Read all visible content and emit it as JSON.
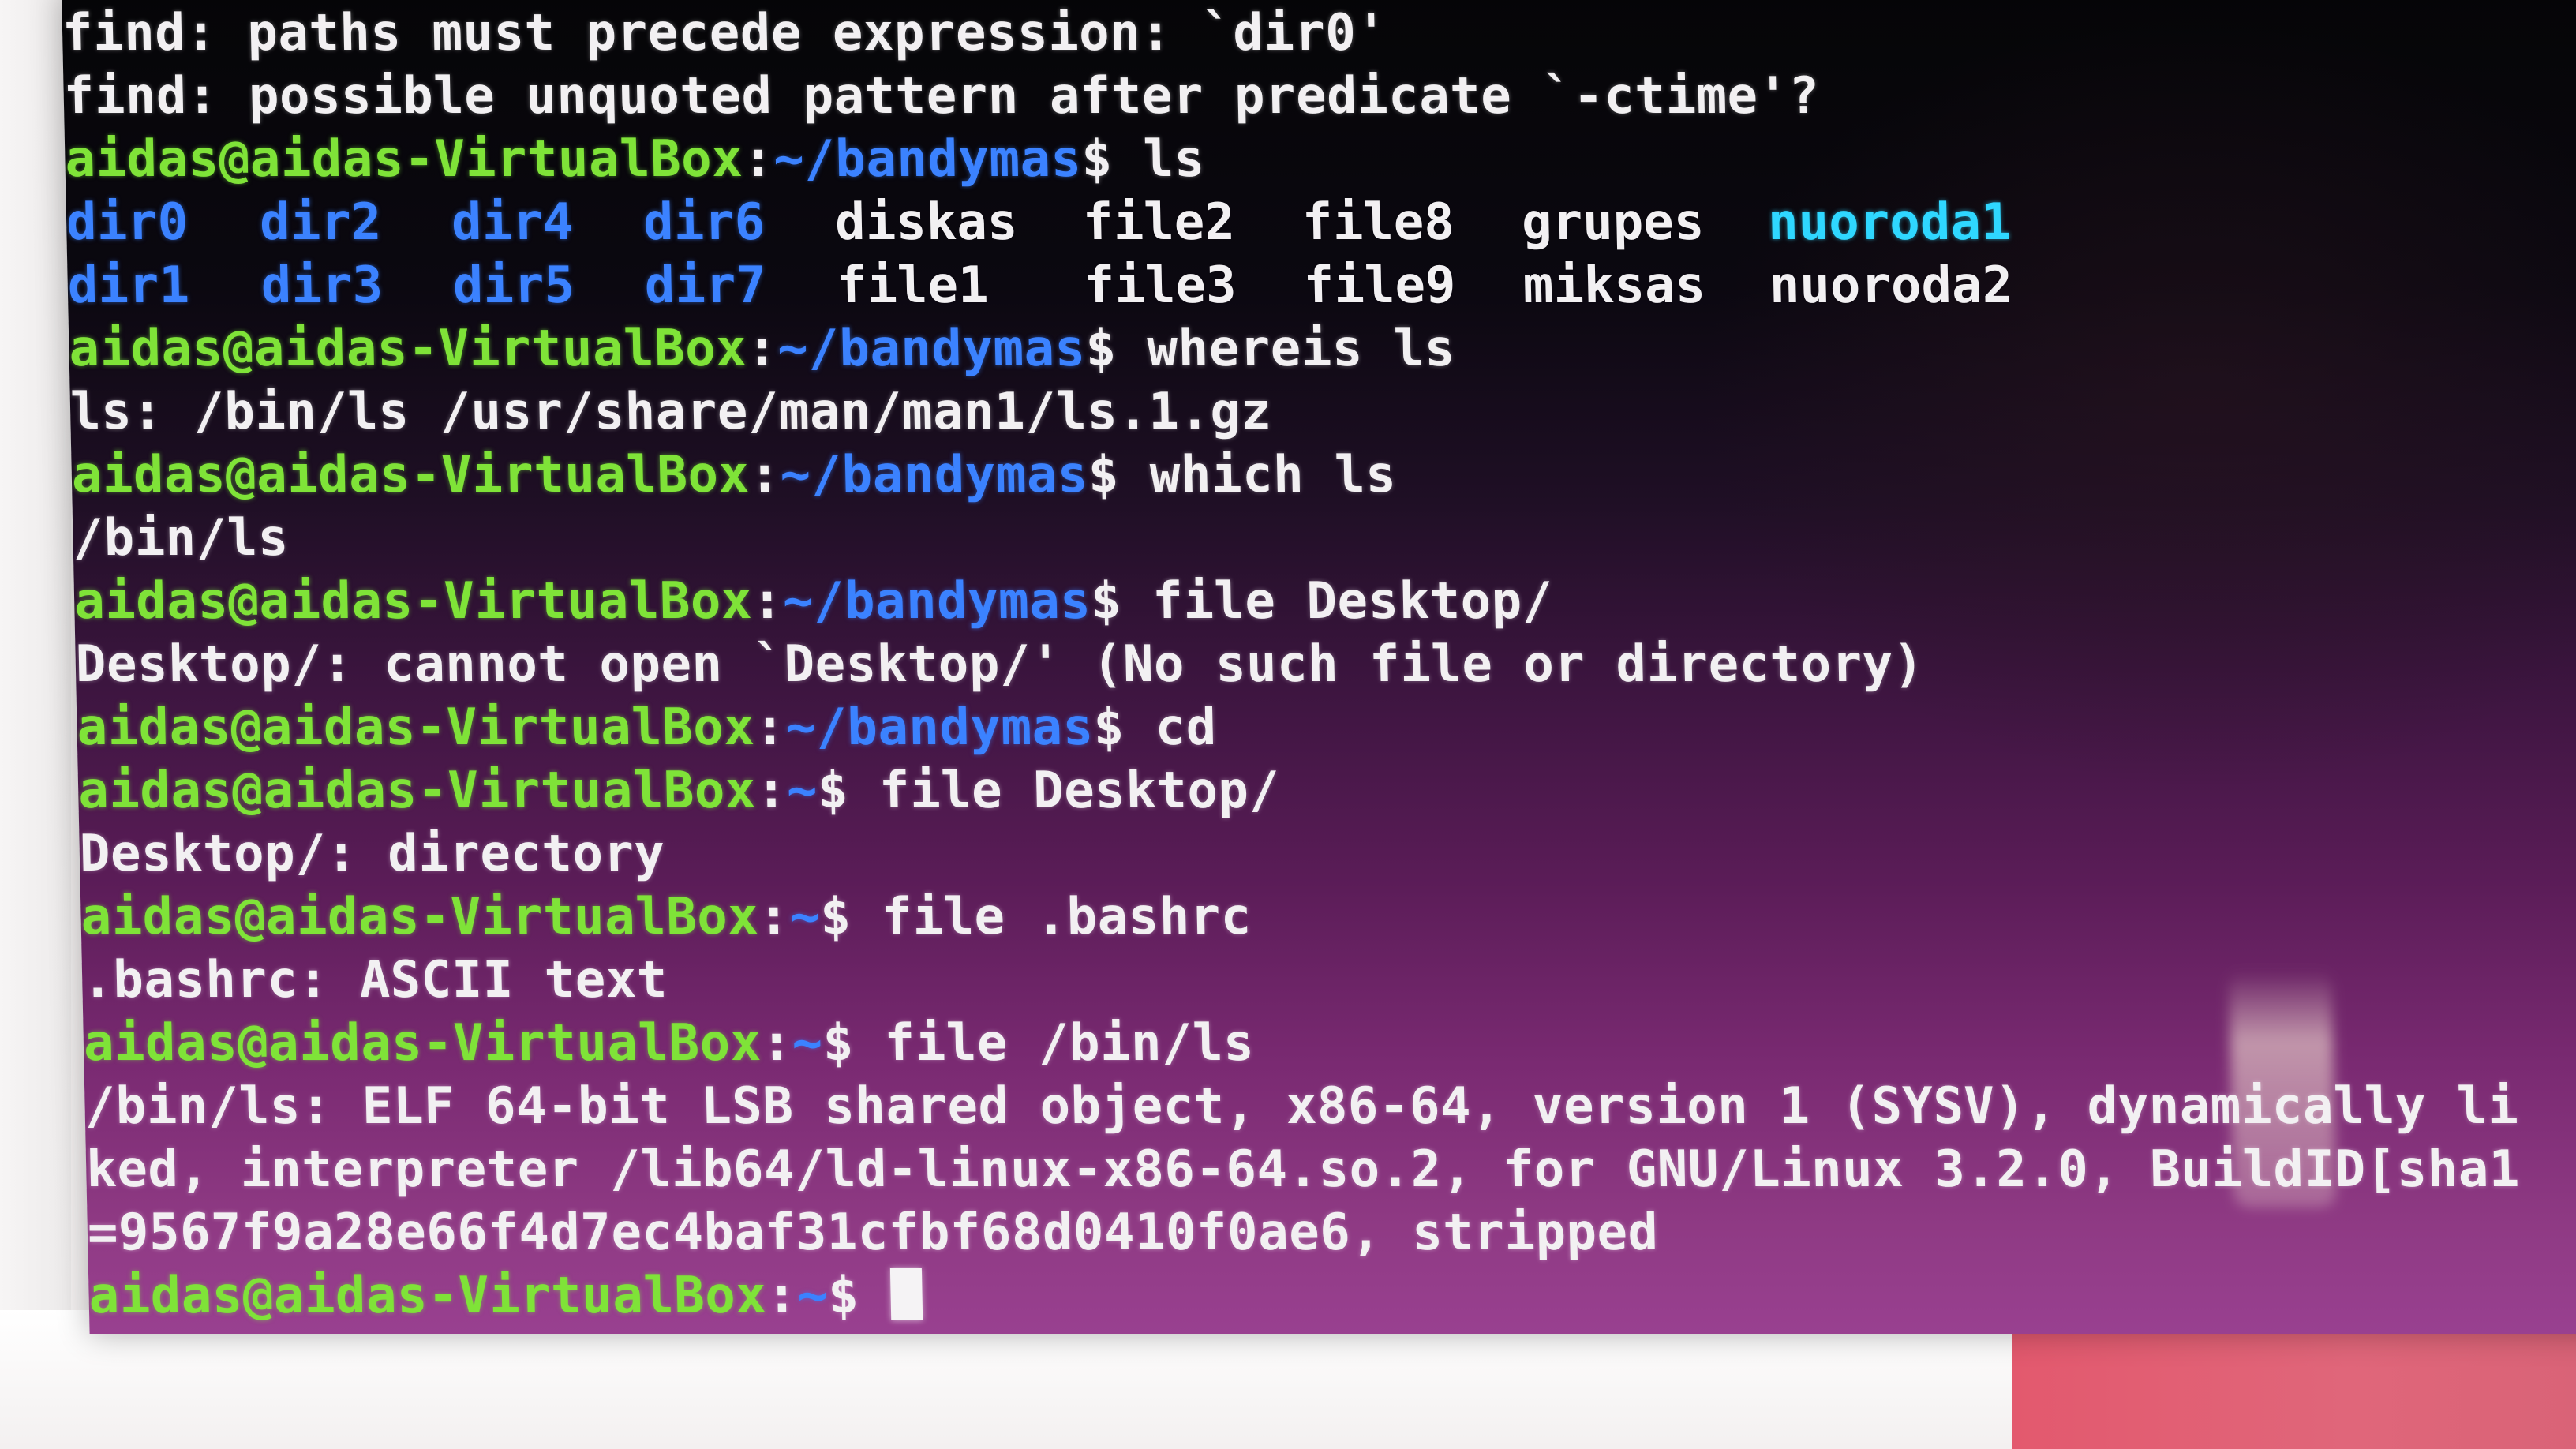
{
  "terminal": {
    "user_host": "aidas@aidas-VirtualBox",
    "lines": [
      {
        "type": "output",
        "text": "find: paths must precede expression: `dir0'"
      },
      {
        "type": "output",
        "text": "find: possible unquoted pattern after predicate `-ctime'?"
      },
      {
        "type": "prompt",
        "path": "~/bandymas",
        "cmd": "ls"
      },
      {
        "type": "ls",
        "cells": [
          {
            "text": "dir0",
            "kind": "dir"
          },
          {
            "text": "dir2",
            "kind": "dir"
          },
          {
            "text": "dir4",
            "kind": "dir"
          },
          {
            "text": "dir6",
            "kind": "dir"
          },
          {
            "text": "diskas",
            "kind": "file"
          },
          {
            "text": "file2",
            "kind": "file"
          },
          {
            "text": "file8",
            "kind": "file"
          },
          {
            "text": "grupes",
            "kind": "file"
          },
          {
            "text": "nuoroda1",
            "kind": "exec"
          }
        ]
      },
      {
        "type": "ls",
        "cells": [
          {
            "text": "dir1",
            "kind": "dir"
          },
          {
            "text": "dir3",
            "kind": "dir"
          },
          {
            "text": "dir5",
            "kind": "dir"
          },
          {
            "text": "dir7",
            "kind": "dir"
          },
          {
            "text": "file1",
            "kind": "file"
          },
          {
            "text": "file3",
            "kind": "file"
          },
          {
            "text": "file9",
            "kind": "file"
          },
          {
            "text": "miksas",
            "kind": "file"
          },
          {
            "text": "nuoroda2",
            "kind": "file"
          }
        ]
      },
      {
        "type": "prompt",
        "path": "~/bandymas",
        "cmd": "whereis ls"
      },
      {
        "type": "output",
        "text": "ls: /bin/ls /usr/share/man/man1/ls.1.gz"
      },
      {
        "type": "prompt",
        "path": "~/bandymas",
        "cmd": "which ls"
      },
      {
        "type": "output",
        "text": "/bin/ls"
      },
      {
        "type": "prompt",
        "path": "~/bandymas",
        "cmd": "file Desktop/"
      },
      {
        "type": "output",
        "text": "Desktop/: cannot open `Desktop/' (No such file or directory)"
      },
      {
        "type": "prompt",
        "path": "~/bandymas",
        "cmd": "cd"
      },
      {
        "type": "prompt",
        "path": "~",
        "cmd": "file Desktop/"
      },
      {
        "type": "output",
        "text": "Desktop/: directory"
      },
      {
        "type": "prompt",
        "path": "~",
        "cmd": "file .bashrc"
      },
      {
        "type": "output",
        "text": ".bashrc: ASCII text"
      },
      {
        "type": "prompt",
        "path": "~",
        "cmd": "file /bin/ls"
      },
      {
        "type": "output",
        "text": "/bin/ls: ELF 64-bit LSB shared object, x86-64, version 1 (SYSV), dynamically li"
      },
      {
        "type": "output",
        "text": "ked, interpreter /lib64/ld-linux-x86-64.so.2, for GNU/Linux 3.2.0, BuildID[sha1"
      },
      {
        "type": "output",
        "text": "=9567f9a28e66f4d7ec4baf31cfbf68d0410f0ae6, stripped"
      },
      {
        "type": "prompt",
        "path": "~",
        "cmd": "",
        "cursor": true
      }
    ]
  },
  "colors": {
    "prompt_green": "#7fe338",
    "path_blue": "#3b82ff",
    "dir_blue": "#3b82ff",
    "exec_cyan": "#2fd7ff",
    "text_white": "#f2f0f2"
  }
}
